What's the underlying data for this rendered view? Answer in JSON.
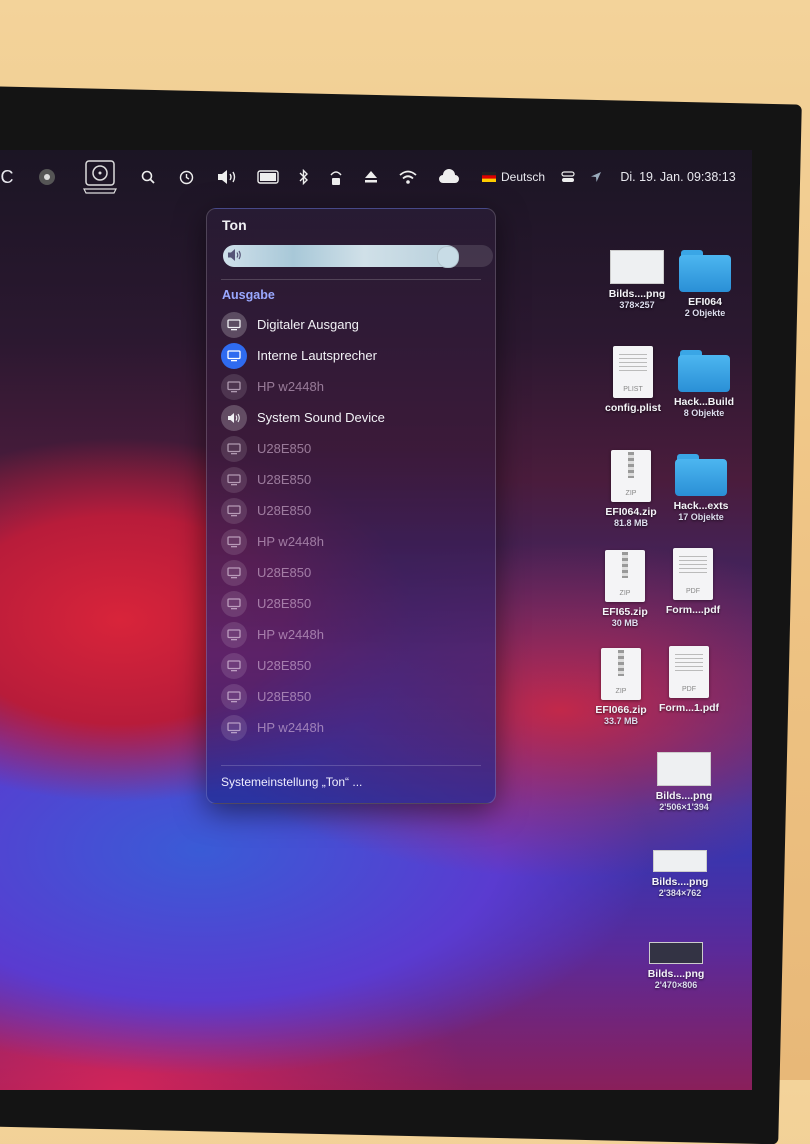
{
  "menubar": {
    "left_glyph": "C",
    "language": "Deutsch",
    "datetime": "Di. 19. Jan. 09:38:13",
    "icons": [
      "gamepad-icon",
      "disk-utility-icon",
      "search-icon",
      "time-machine-icon",
      "volume-icon",
      "battery-icon",
      "bluetooth-icon",
      "vpn-icon",
      "eject-icon",
      "wifi-icon",
      "cloud-sync-icon",
      "flag-icon",
      "control-center-icon",
      "location-icon"
    ]
  },
  "sound_panel": {
    "title": "Ton",
    "volume_percent": 87,
    "section_label": "Ausgabe",
    "devices": [
      {
        "label": "Digitaler Ausgang",
        "icon": "display-icon",
        "state": "on",
        "selected": false
      },
      {
        "label": "Interne Lautsprecher",
        "icon": "display-icon",
        "state": "on",
        "selected": true
      },
      {
        "label": "HP w2448h",
        "icon": "display-icon",
        "state": "off",
        "selected": false
      },
      {
        "label": "System Sound Device",
        "icon": "speaker-icon",
        "state": "on",
        "selected": false
      },
      {
        "label": "U28E850",
        "icon": "display-icon",
        "state": "off",
        "selected": false
      },
      {
        "label": "U28E850",
        "icon": "display-icon",
        "state": "off",
        "selected": false
      },
      {
        "label": "U28E850",
        "icon": "display-icon",
        "state": "off",
        "selected": false
      },
      {
        "label": "HP w2448h",
        "icon": "display-icon",
        "state": "off",
        "selected": false
      },
      {
        "label": "U28E850",
        "icon": "display-icon",
        "state": "off",
        "selected": false
      },
      {
        "label": "U28E850",
        "icon": "display-icon",
        "state": "off",
        "selected": false
      },
      {
        "label": "HP w2448h",
        "icon": "display-icon",
        "state": "off",
        "selected": false
      },
      {
        "label": "U28E850",
        "icon": "display-icon",
        "state": "off",
        "selected": false
      },
      {
        "label": "U28E850",
        "icon": "display-icon",
        "state": "off",
        "selected": false
      },
      {
        "label": "HP w2448h",
        "icon": "display-icon",
        "state": "off",
        "selected": false
      }
    ],
    "footer": "Systemeinstellung „Ton“ ..."
  },
  "desktop": [
    {
      "name": "Bilds....png",
      "size": "378×257",
      "kind": "image"
    },
    {
      "name": "EFI064",
      "size": "2 Objekte",
      "kind": "folder"
    },
    {
      "name": "config.plist",
      "size": "",
      "kind": "plist"
    },
    {
      "name": "Hack...Build",
      "size": "8 Objekte",
      "kind": "folder"
    },
    {
      "name": "EFI064.zip",
      "size": "81.8 MB",
      "kind": "zip"
    },
    {
      "name": "Hack...exts",
      "size": "17 Objekte",
      "kind": "folder"
    },
    {
      "name": "EFI65.zip",
      "size": "30 MB",
      "kind": "zip"
    },
    {
      "name": "Form....pdf",
      "size": "",
      "kind": "pdf"
    },
    {
      "name": "EFI066.zip",
      "size": "33.7 MB",
      "kind": "zip"
    },
    {
      "name": "Form...1.pdf",
      "size": "",
      "kind": "pdf"
    },
    {
      "name": "Bilds....png",
      "size": "2'506×1'394",
      "kind": "image"
    },
    {
      "name": "Bilds....png",
      "size": "2'384×762",
      "kind": "image"
    },
    {
      "name": "Bilds....png",
      "size": "2'470×806",
      "kind": "image"
    }
  ],
  "colors": {
    "accent": "#2f6bf0",
    "section": "#9aa8ff"
  }
}
